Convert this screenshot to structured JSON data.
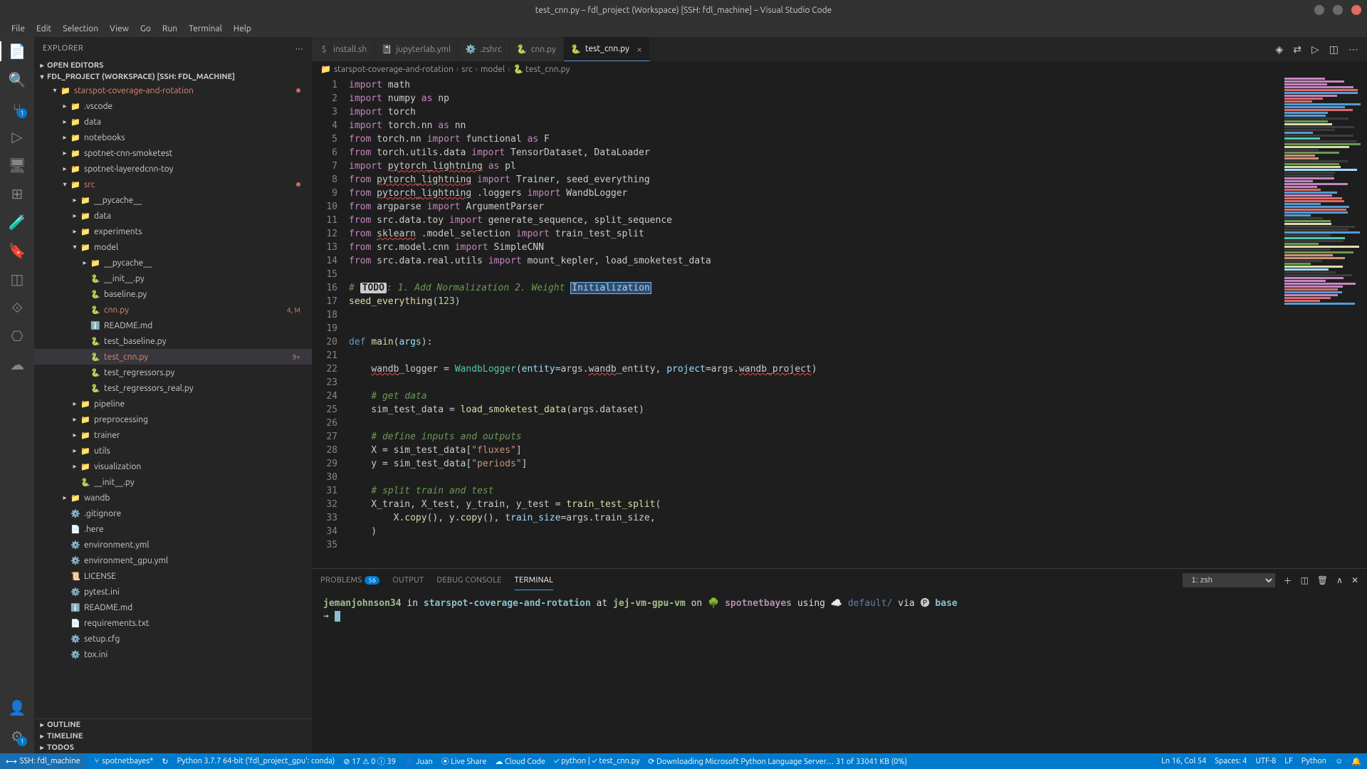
{
  "window": {
    "title": "test_cnn.py – fdl_project (Workspace) [SSH: fdl_machine] – Visual Studio Code"
  },
  "menu": [
    "File",
    "Edit",
    "Selection",
    "View",
    "Go",
    "Run",
    "Terminal",
    "Help"
  ],
  "sidebar": {
    "title": "EXPLORER",
    "open_editors": "OPEN EDITORS",
    "project": "FDL_PROJECT (WORKSPACE) [SSH: FDL_MACHINE]",
    "outline": "OUTLINE",
    "timeline": "TIMELINE",
    "todos": "TODOS",
    "tree": [
      {
        "depth": 1,
        "chev": "▾",
        "icon": "📁",
        "name": "starspot-coverage-and-rotation",
        "cls": "red",
        "trail": "dot"
      },
      {
        "depth": 2,
        "chev": "▸",
        "icon": "📁",
        "name": ".vscode",
        "cls": "folder"
      },
      {
        "depth": 2,
        "chev": "▸",
        "icon": "📁",
        "name": "data",
        "cls": "folder"
      },
      {
        "depth": 2,
        "chev": "▸",
        "icon": "📁",
        "name": "notebooks",
        "cls": "folder"
      },
      {
        "depth": 2,
        "chev": "▸",
        "icon": "📁",
        "name": "spotnet-cnn-smoketest",
        "cls": "folder"
      },
      {
        "depth": 2,
        "chev": "▸",
        "icon": "📁",
        "name": "spotnet-layeredcnn-toy",
        "cls": "folder"
      },
      {
        "depth": 2,
        "chev": "▾",
        "icon": "📁",
        "name": "src",
        "cls": "red",
        "trail": "dot"
      },
      {
        "depth": 3,
        "chev": "▸",
        "icon": "📁",
        "name": "__pycache__",
        "cls": "folder"
      },
      {
        "depth": 3,
        "chev": "▸",
        "icon": "📁",
        "name": "data",
        "cls": "folder"
      },
      {
        "depth": 3,
        "chev": "▸",
        "icon": "📁",
        "name": "experiments",
        "cls": "folder"
      },
      {
        "depth": 3,
        "chev": "▾",
        "icon": "📁",
        "name": "model",
        "cls": "folder"
      },
      {
        "depth": 4,
        "chev": "▸",
        "icon": "📁",
        "name": "__pycache__",
        "cls": "folder"
      },
      {
        "depth": 4,
        "icon": "🐍",
        "name": "__init__.py"
      },
      {
        "depth": 4,
        "icon": "🐍",
        "name": "baseline.py"
      },
      {
        "depth": 4,
        "icon": "🐍",
        "name": "cnn.py",
        "cls": "orange",
        "trail": "4, M"
      },
      {
        "depth": 4,
        "icon": "ℹ️",
        "name": "README.md"
      },
      {
        "depth": 4,
        "icon": "🐍",
        "name": "test_baseline.py"
      },
      {
        "depth": 4,
        "icon": "🐍",
        "name": "test_cnn.py",
        "cls": "orange",
        "active": true,
        "trail": "9+"
      },
      {
        "depth": 4,
        "icon": "🐍",
        "name": "test_regressors.py"
      },
      {
        "depth": 4,
        "icon": "🐍",
        "name": "test_regressors_real.py"
      },
      {
        "depth": 3,
        "chev": "▸",
        "icon": "📁",
        "name": "pipeline",
        "cls": "folder"
      },
      {
        "depth": 3,
        "chev": "▸",
        "icon": "📁",
        "name": "preprocessing",
        "cls": "folder"
      },
      {
        "depth": 3,
        "chev": "▸",
        "icon": "📁",
        "name": "trainer",
        "cls": "folder"
      },
      {
        "depth": 3,
        "chev": "▸",
        "icon": "📁",
        "name": "utils",
        "cls": "folder"
      },
      {
        "depth": 3,
        "chev": "▸",
        "icon": "📁",
        "name": "visualization",
        "cls": "folder"
      },
      {
        "depth": 3,
        "icon": "🐍",
        "name": "__init__.py"
      },
      {
        "depth": 2,
        "chev": "▸",
        "icon": "📁",
        "name": "wandb",
        "cls": "folder"
      },
      {
        "depth": 2,
        "icon": "⚙️",
        "name": ".gitignore"
      },
      {
        "depth": 2,
        "icon": "📄",
        "name": ".here"
      },
      {
        "depth": 2,
        "icon": "⚙️",
        "name": "environment.yml"
      },
      {
        "depth": 2,
        "icon": "⚙️",
        "name": "environment_gpu.yml"
      },
      {
        "depth": 2,
        "icon": "📜",
        "name": "LICENSE"
      },
      {
        "depth": 2,
        "icon": "⚙️",
        "name": "pytest.ini"
      },
      {
        "depth": 2,
        "icon": "ℹ️",
        "name": "README.md"
      },
      {
        "depth": 2,
        "icon": "📄",
        "name": "requirements.txt"
      },
      {
        "depth": 2,
        "icon": "⚙️",
        "name": "setup.cfg"
      },
      {
        "depth": 2,
        "icon": "⚙️",
        "name": "tox.ini"
      }
    ]
  },
  "tabs": [
    {
      "icon": "$",
      "name": "install.sh"
    },
    {
      "icon": "📓",
      "name": "jupyterlab.yml"
    },
    {
      "icon": "⚙️",
      "name": ".zshrc"
    },
    {
      "icon": "🐍",
      "name": "cnn.py"
    },
    {
      "icon": "🐍",
      "name": "test_cnn.py",
      "active": true,
      "close": true
    }
  ],
  "breadcrumbs": [
    "starspot-coverage-and-rotation",
    "src",
    "model",
    "test_cnn.py"
  ],
  "code": {
    "first_line": 1,
    "lines": [
      [
        [
          "kw",
          "import"
        ],
        [
          "",
          ". math"
        ]
      ],
      [
        [
          "kw",
          "import"
        ],
        [
          "",
          " numpy "
        ],
        [
          "kw",
          "as"
        ],
        [
          "",
          " np"
        ]
      ],
      [
        [
          "kw",
          "import"
        ],
        [
          "",
          " torch"
        ]
      ],
      [
        [
          "kw",
          "import"
        ],
        [
          "",
          " torch.nn "
        ],
        [
          "kw",
          "as"
        ],
        [
          "",
          " nn"
        ]
      ],
      [
        [
          "kw",
          "from"
        ],
        [
          "",
          " torch.nn "
        ],
        [
          "kw",
          "import"
        ],
        [
          "",
          " functional "
        ],
        [
          "kw",
          "as"
        ],
        [
          "",
          " F"
        ]
      ],
      [
        [
          "kw",
          "from"
        ],
        [
          "",
          " torch.utils.data "
        ],
        [
          "kw",
          "import"
        ],
        [
          "",
          " TensorDataset, DataLoader"
        ]
      ],
      [
        [
          "kw",
          "import"
        ],
        [
          "",
          " "
        ],
        [
          "underline",
          "pytorch_lightning"
        ],
        [
          "",
          " "
        ],
        [
          "kw",
          "as"
        ],
        [
          "",
          " pl"
        ]
      ],
      [
        [
          "kw",
          "from"
        ],
        [
          "",
          " "
        ],
        [
          "underline",
          "pytorch_lightning"
        ],
        [
          "",
          " "
        ],
        [
          "kw",
          "import"
        ],
        [
          "",
          " Trainer, seed_everything"
        ]
      ],
      [
        [
          "kw",
          "from"
        ],
        [
          "",
          " "
        ],
        [
          "underline",
          "pytorch_lightning"
        ],
        [
          "",
          " .loggers "
        ],
        [
          "kw",
          "import"
        ],
        [
          "",
          " WandbLogger"
        ]
      ],
      [
        [
          "kw",
          "from"
        ],
        [
          "",
          " argparse "
        ],
        [
          "kw",
          "import"
        ],
        [
          "",
          " ArgumentParser"
        ]
      ],
      [
        [
          "kw",
          "from"
        ],
        [
          "",
          " src.data.toy "
        ],
        [
          "kw",
          "import"
        ],
        [
          "",
          " generate_sequence, split_sequence"
        ]
      ],
      [
        [
          "kw",
          "from"
        ],
        [
          "",
          " "
        ],
        [
          "underline",
          "sklearn"
        ],
        [
          "",
          " .model_selection "
        ],
        [
          "kw",
          "import"
        ],
        [
          "",
          " train_test_split"
        ]
      ],
      [
        [
          "kw",
          "from"
        ],
        [
          "",
          " src.model.cnn "
        ],
        [
          "kw",
          "import"
        ],
        [
          "",
          " SimpleCNN"
        ]
      ],
      [
        [
          "kw",
          "from"
        ],
        [
          "",
          " src.data.real.utils "
        ],
        [
          "kw",
          "import"
        ],
        [
          "",
          " mount_kepler, load_smoketest_data"
        ]
      ],
      [
        [
          "",
          ""
        ]
      ],
      [
        [
          "cmt",
          "# "
        ],
        [
          "todo-box",
          "TODO"
        ],
        [
          "cmt",
          ": 1. Add Normalization 2. Weight "
        ],
        [
          "sel",
          "Initialization"
        ]
      ],
      [
        [
          "fn",
          "seed_everything"
        ],
        [
          "",
          "("
        ],
        [
          "num",
          "123"
        ],
        [
          "",
          ")"
        ]
      ],
      [
        [
          "",
          ""
        ]
      ],
      [
        [
          "",
          ""
        ]
      ],
      [
        [
          "kw2",
          "def"
        ],
        [
          "",
          " "
        ],
        [
          "fn",
          "main"
        ],
        [
          "",
          "("
        ],
        [
          "param",
          "args"
        ],
        [
          "",
          "):"
        ]
      ],
      [
        [
          "",
          ""
        ]
      ],
      [
        [
          "",
          "    "
        ],
        [
          "underline",
          "wandb"
        ],
        [
          "",
          "_logger = "
        ],
        [
          "cls",
          "WandbLogger"
        ],
        [
          "",
          "("
        ],
        [
          "param",
          "entity"
        ],
        [
          "",
          "=args."
        ],
        [
          "underline",
          "wandb"
        ],
        [
          "",
          "_entity, "
        ],
        [
          "param",
          "project"
        ],
        [
          "",
          "=args."
        ],
        [
          "underline",
          "wandb_project"
        ],
        [
          "",
          ")"
        ]
      ],
      [
        [
          "",
          ""
        ]
      ],
      [
        [
          "",
          "    "
        ],
        [
          "cmt",
          "# get data"
        ]
      ],
      [
        [
          "",
          "    sim_test_data = "
        ],
        [
          "fn",
          "load_smoketest_data"
        ],
        [
          "",
          "(args.dataset)"
        ]
      ],
      [
        [
          "",
          ""
        ]
      ],
      [
        [
          "",
          "    "
        ],
        [
          "cmt",
          "# define inputs and outputs"
        ]
      ],
      [
        [
          "",
          "    X = sim_test_data["
        ],
        [
          "str",
          "\"fluxes\""
        ],
        [
          "",
          "]"
        ]
      ],
      [
        [
          "",
          "    y = sim_test_data["
        ],
        [
          "str",
          "\"periods\""
        ],
        [
          "",
          "]"
        ]
      ],
      [
        [
          "",
          ""
        ]
      ],
      [
        [
          "",
          "    "
        ],
        [
          "cmt",
          "# split train and test"
        ]
      ],
      [
        [
          "",
          "    X_train, X_test, y_train, y_test = "
        ],
        [
          "fn",
          "train_test_split"
        ],
        [
          "",
          "("
        ]
      ],
      [
        [
          "",
          "        X."
        ],
        [
          "fn",
          "copy"
        ],
        [
          "",
          "(), y."
        ],
        [
          "fn",
          "copy"
        ],
        [
          "",
          "(), "
        ],
        [
          "param",
          "train_size"
        ],
        [
          "",
          "=args.train_size,"
        ]
      ],
      [
        [
          "",
          "    )"
        ]
      ],
      [
        [
          "",
          ""
        ]
      ]
    ]
  },
  "panel": {
    "tabs": {
      "problems": "PROBLEMS",
      "problems_count": "56",
      "output": "OUTPUT",
      "debug": "DEBUG CONSOLE",
      "terminal": "TERMINAL"
    },
    "shell_label": "1: zsh"
  },
  "terminal": {
    "user": "jemanjohnson34",
    "in": " in ",
    "repo": "starspot-coverage-and-rotation",
    "at": " at ",
    "host": "jej-vm-gpu-vm",
    "on": " on 🌳 ",
    "branch": "spotnetbayes",
    "using": " using ",
    "cloud": "☁️ ",
    "profile": "default/",
    "via": " via ",
    "pycircle": "🅟 ",
    "env": "base",
    "prompt": "→ "
  },
  "statusbar": {
    "remote": "SSH: fdl_machine",
    "branch": "spotnetbayes*",
    "sync": "↻",
    "python": "Python 3.7.7 64-bit ('fdl_project_gpu': conda)",
    "errors": "⊘ 17 ⚠ 0 ⓘ 39",
    "user": "👤 Juan",
    "liveshare": "⦿ Live Share",
    "cloudcode": "☁ Cloud Code",
    "lang": "✓ python | ✓ test_cnn.py",
    "download": "⟳ Downloading Microsoft Python Language Server… 31 of 33041 KB (0%)",
    "lncol": "Ln 16, Col 54",
    "spaces": "Spaces: 4",
    "encoding": "UTF-8",
    "eol": "LF",
    "langlabel": "Python",
    "feedback": "☺",
    "bell": "🔔"
  }
}
